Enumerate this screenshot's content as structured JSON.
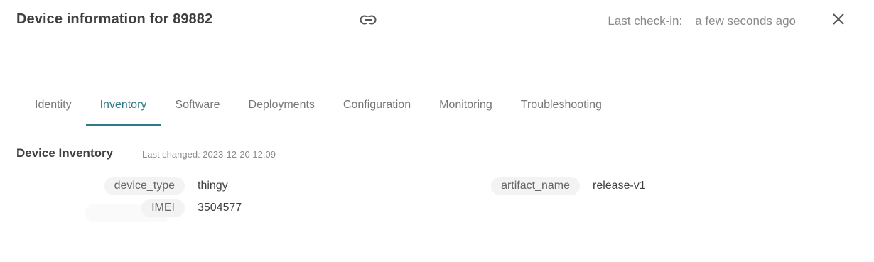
{
  "header": {
    "title": "Device information for 89882",
    "link_icon": "link-icon",
    "last_checkin_label": "Last check-in:",
    "last_checkin_value": "a few seconds ago",
    "close_icon": "close-icon"
  },
  "tabs": [
    {
      "label": "Identity",
      "active": false
    },
    {
      "label": "Inventory",
      "active": true
    },
    {
      "label": "Software",
      "active": false
    },
    {
      "label": "Deployments",
      "active": false
    },
    {
      "label": "Configuration",
      "active": false
    },
    {
      "label": "Monitoring",
      "active": false
    },
    {
      "label": "Troubleshooting",
      "active": false
    }
  ],
  "inventory": {
    "title": "Device Inventory",
    "last_changed": "Last changed: 2023-12-20 12:09",
    "left_attributes": [
      {
        "key": "device_type",
        "value": "thingy"
      },
      {
        "key": "IMEI",
        "value": "3504577"
      }
    ],
    "right_attributes": [
      {
        "key": "artifact_name",
        "value": "release-v1"
      }
    ]
  },
  "colors": {
    "accent": "#2f7a86",
    "muted_text": "#8a8a8a",
    "pill_bg": "#f3f3f3"
  }
}
